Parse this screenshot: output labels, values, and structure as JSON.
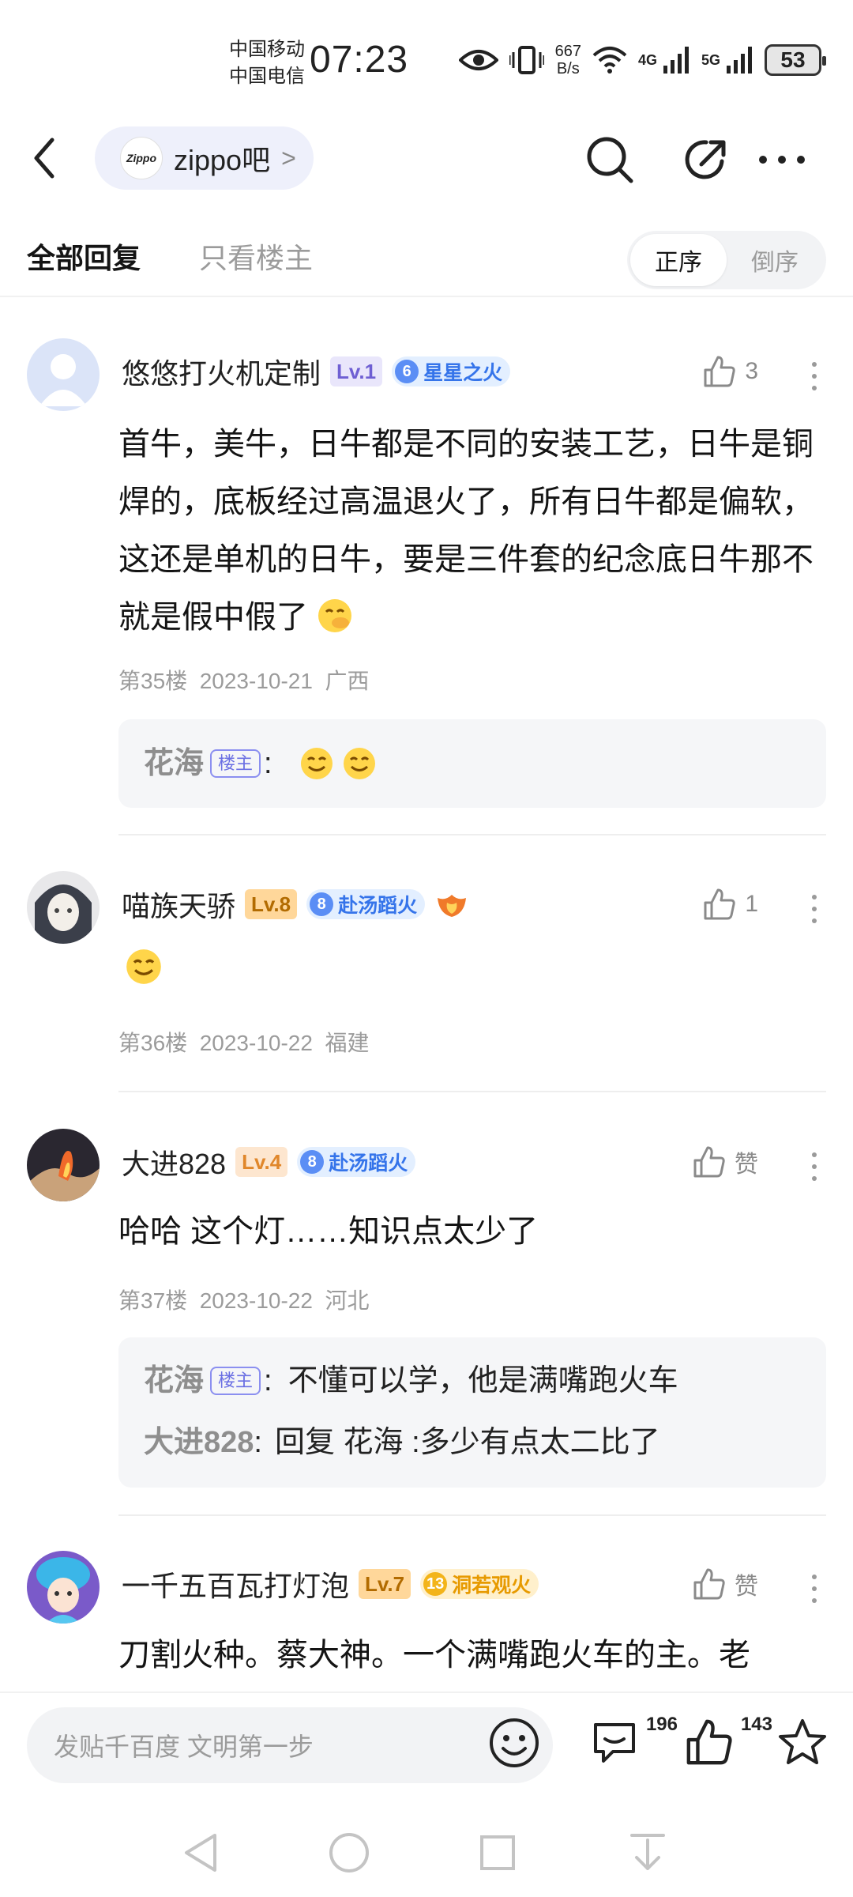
{
  "status_bar": {
    "carrier_1": "中国移动",
    "carrier_2": "中国电信",
    "time": "07:23",
    "net_speed_value": "667",
    "net_speed_unit": "B/s",
    "net_1": "4G",
    "net_2": "5G",
    "battery": "53"
  },
  "header": {
    "forum_logo": "Zippo",
    "forum_name": "zippo吧",
    "forum_chevron": ">"
  },
  "filters": {
    "tab_all": "全部回复",
    "tab_op_only": "只看楼主",
    "sort_asc": "正序",
    "sort_desc": "倒序"
  },
  "posts": [
    {
      "username": "悠悠打火机定制",
      "level": "Lv.1",
      "honor_num": "6",
      "honor_name": "星星之火",
      "likes": "3",
      "content": "首牛，美牛，日牛都是不同的安装工艺，日牛是铜焊的，底板经过高温退火了，所有日牛都是偏软，这还是单机的日牛，要是三件套的纪念底日牛那不就是假中假了",
      "floor": "第35楼",
      "date": "2023-10-21",
      "location": "广西",
      "replies": [
        {
          "author": "花海",
          "op_tag": "楼主",
          "sep": ":",
          "text": ""
        }
      ]
    },
    {
      "username": "喵族天骄",
      "level": "Lv.8",
      "honor_num": "8",
      "honor_name": "赴汤蹈火",
      "likes": "1",
      "content": "",
      "floor": "第36楼",
      "date": "2023-10-22",
      "location": "福建"
    },
    {
      "username": "大进828",
      "level": "Lv.4",
      "honor_num": "8",
      "honor_name": "赴汤蹈火",
      "likes": "赞",
      "content": "哈哈 这个灯……知识点太少了",
      "floor": "第37楼",
      "date": "2023-10-22",
      "location": "河北",
      "replies": [
        {
          "author": "花海",
          "op_tag": "楼主",
          "sep": ":",
          "text": "不懂可以学，他是满嘴跑火车"
        },
        {
          "author": "大进828",
          "sep": ":",
          "text": "回复 花海 :多少有点太二比了"
        }
      ]
    },
    {
      "username": "一千五百瓦打灯泡",
      "level": "Lv.7",
      "honor_num": "13",
      "honor_name": "洞若观火",
      "likes": "赞",
      "content": "刀割火种。蔡大神。一个满嘴跑火车的主。老"
    }
  ],
  "bottom_bar": {
    "input_placeholder": "发贴千百度 文明第一步",
    "comment_count": "196",
    "like_count": "143"
  },
  "colors": {
    "accent_purple": "#6e5fd3",
    "badge_blue": "#3574ea",
    "badge_gold": "#e79a00",
    "muted_text": "#9b9b9b"
  },
  "icons": {
    "back": "chevron-left-icon",
    "search": "search-icon",
    "share": "share-icon",
    "more": "more-icon",
    "like": "thumbs-up-icon",
    "emoji": "emoji-icon",
    "comment": "comment-icon",
    "favorite": "star-icon"
  }
}
